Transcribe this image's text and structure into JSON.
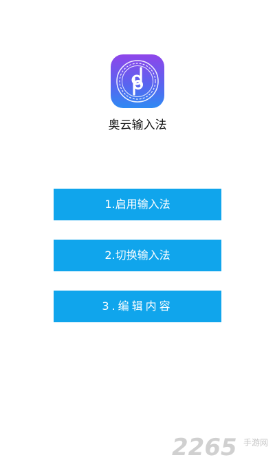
{
  "app": {
    "name": "奥云输入法"
  },
  "buttons": {
    "enable_ime": "1.启用输入法",
    "switch_ime": "2.切换输入法",
    "edit_content": "3.编辑内容"
  },
  "watermark": {
    "number": "2265",
    "site_cn": "手游网"
  },
  "colors": {
    "button_bg": "#10a5ec",
    "icon_gradient_top": "#8f45ea",
    "icon_gradient_bottom": "#2f8af3"
  },
  "icons": {
    "app_logo": "dq-logo-icon"
  }
}
